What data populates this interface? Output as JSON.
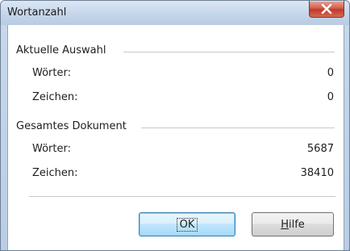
{
  "window": {
    "title": "Wortanzahl",
    "close_icon": "close-x-icon"
  },
  "selection": {
    "header": "Aktuelle Auswahl",
    "words_label": "Wörter:",
    "words_value": "0",
    "chars_label": "Zeichen:",
    "chars_value": "0"
  },
  "document": {
    "header": "Gesamtes Dokument",
    "words_label": "Wörter:",
    "words_value": "5687",
    "chars_label": "Zeichen:",
    "chars_value": "38410"
  },
  "buttons": {
    "ok_label": "OK",
    "help_mnemonic": "H",
    "help_rest": "ilfe"
  },
  "colors": {
    "close_button": "#c0392b",
    "default_button_border": "#3c7fb1"
  }
}
